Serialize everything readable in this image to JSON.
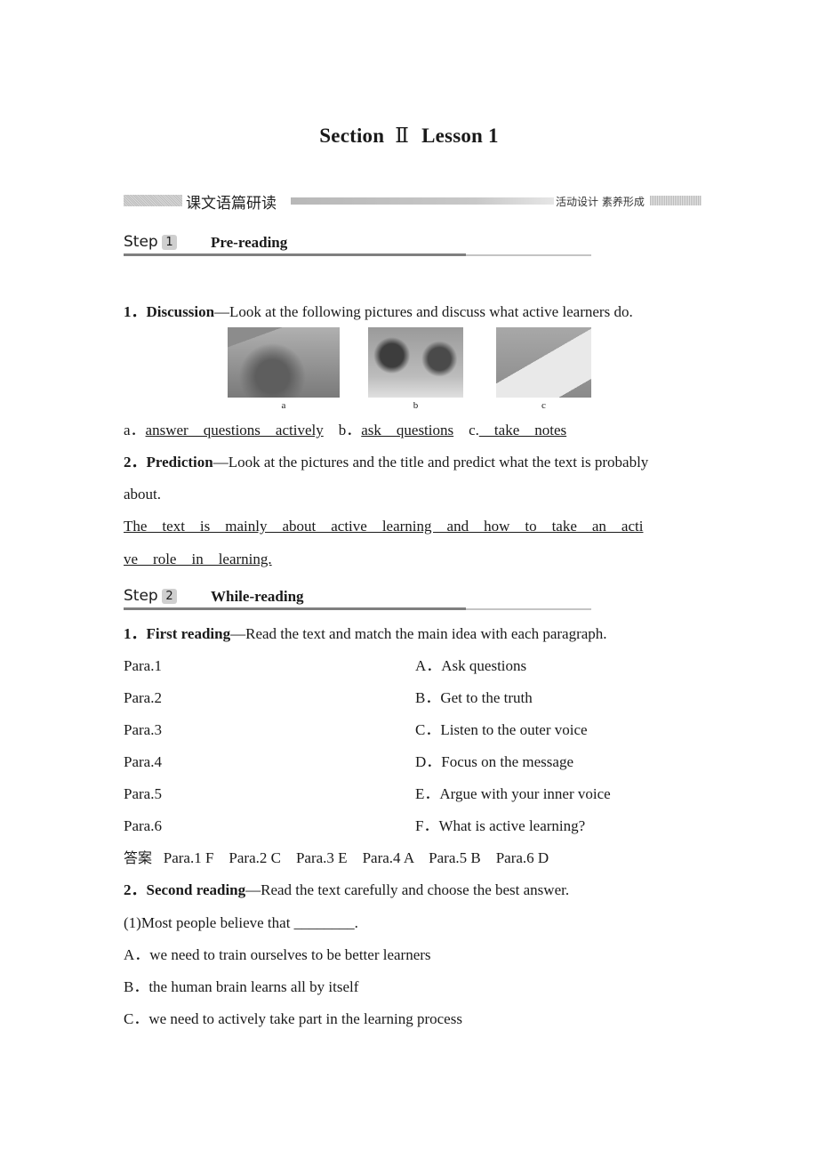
{
  "header": {
    "title_left": "Section",
    "title_roman": "Ⅱ",
    "title_right": "Lesson 1"
  },
  "banner": {
    "title": "课文语篇研读",
    "subtitle": "活动设计  素养形成"
  },
  "step1": {
    "word": "Step",
    "num": "1",
    "title": "Pre-reading",
    "discussion": {
      "num": "1．",
      "label": "Discussion",
      "text": "—Look at the following pictures and discuss what active learners do."
    },
    "pictures": [
      {
        "caption": "a",
        "icon": "classroom-photo"
      },
      {
        "caption": "b",
        "icon": "students-group-photo"
      },
      {
        "caption": "c",
        "icon": "note-taking-photo"
      }
    ],
    "answers": {
      "a_label": "a．",
      "a_value": "answer__questions__actively",
      "b_label": "b．",
      "b_value": "ask__questions",
      "c_label": "c.",
      "c_value": "__take__notes"
    },
    "prediction": {
      "num": "2．",
      "label": "Prediction",
      "text": "—Look at the pictures and the title and predict what the text is probably",
      "text_cont": "about.",
      "answer_line1": "The    text    is    mainly    about    active    learning    and    how    to    take    an    acti",
      "answer_line2": "ve    role    in    learning."
    }
  },
  "step2": {
    "word": "Step",
    "num": "2",
    "title": "While-reading",
    "first_reading": {
      "num": "1．",
      "label": "First reading",
      "text": "—Read the text and match the main idea with each paragraph."
    },
    "paras": [
      "Para.1",
      "Para.2",
      "Para.3",
      "Para.4",
      "Para.5",
      "Para.6"
    ],
    "options": [
      "A．Ask questions",
      "B．Get to the truth",
      "C．Listen to the outer voice",
      "D．Focus on the message",
      "E．Argue with your inner voice",
      "F．What is active learning?"
    ],
    "answer": {
      "label": "答案",
      "value": "Para.1 F    Para.2 C    Para.3 E    Para.4 A    Para.5 B    Para.6 D"
    },
    "second_reading": {
      "num": "2．",
      "label": "Second reading",
      "text": "—Read the text carefully and choose the best answer."
    },
    "q1": {
      "stem": "(1)Most people believe that ________.",
      "choices": [
        "A．we need to train ourselves to be better learners",
        "B．the human brain learns all by itself",
        "C．we need to actively take part in the learning process"
      ]
    }
  }
}
